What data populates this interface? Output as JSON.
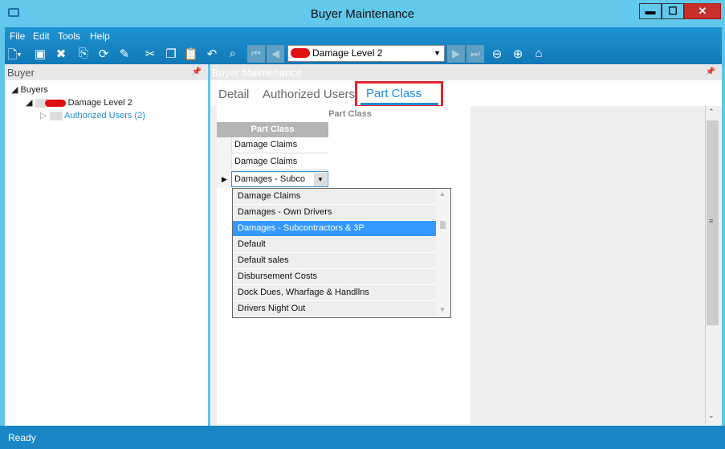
{
  "window": {
    "title": "Buyer Maintenance",
    "minimize": "▬",
    "maximize": "☐",
    "close": "✕"
  },
  "menu": [
    "File",
    "Edit",
    "Tools",
    "Help"
  ],
  "toolbar": {
    "record_combo": "Damage Level 2"
  },
  "left_panel": {
    "title": "Buyer",
    "tree": {
      "root": "Buyers",
      "node": "Damage Level 2",
      "child": "Authorized Users (2)"
    }
  },
  "right_panel": {
    "title": "Buyer Maintenance",
    "tabs": [
      "Detail",
      "Authorized Users",
      "Part Class"
    ],
    "active_tab": "Part Class"
  },
  "grid": {
    "caption": "Part Class",
    "header": "Part Class",
    "rows": [
      "Damage Claims",
      "Damage Claims"
    ],
    "editing_value": "Damages - Subco"
  },
  "dropdown": {
    "options": [
      "Damage Claims",
      "Damages - Own Drivers",
      "Damages - Subcontractors & 3P",
      "Default",
      "Default sales",
      "Disbursement Costs",
      "Dock Dues, Wharfage & Handllns",
      "Drivers Night Out"
    ],
    "selected": "Damages - Subcontractors & 3P"
  },
  "status": "Ready",
  "colors": {
    "accent": "#1e8ad6",
    "highlight": "#3399ff",
    "red_box": "#e3262b"
  }
}
